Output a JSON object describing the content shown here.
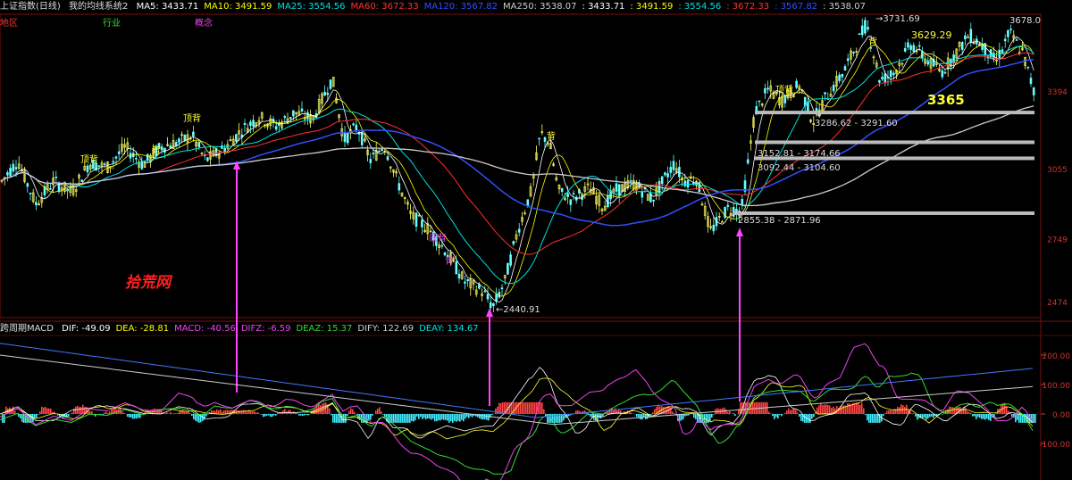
{
  "header": {
    "index_name": "上证指数(日线)",
    "indicator_name": "我的均线系统2",
    "ma": [
      {
        "label": "MA5: 3433.71",
        "color": "#ffffff"
      },
      {
        "label": "MA10: 3491.59",
        "color": "#ffff00"
      },
      {
        "label": "MA25: 3554.56",
        "color": "#00e0e0"
      },
      {
        "label": "MA60: 3672.33",
        "color": "#ff3030"
      },
      {
        "label": "MA120: 3567.82",
        "color": "#3050ff"
      },
      {
        "label": "MA250: 3538.07",
        "color": "#cccccc"
      },
      {
        "label": ": 3433.71",
        "color": "#ffffff"
      },
      {
        "label": ": 3491.59",
        "color": "#ffff00"
      },
      {
        "label": ": 3554.56",
        "color": "#00e0e0"
      },
      {
        "label": ": 3672.33",
        "color": "#ff3030"
      },
      {
        "label": ": 3567.82",
        "color": "#3050ff"
      },
      {
        "label": ": 3538.07",
        "color": "#cccccc"
      }
    ]
  },
  "tabs": [
    {
      "label": "地区",
      "color": "#ff3030"
    },
    {
      "label": "行业",
      "color": "#33dd33"
    },
    {
      "label": "概念",
      "color": "#ee44ee"
    }
  ],
  "watermark": "拾荒网",
  "chart_data": [
    {
      "type": "line",
      "title": "上证指数(日线)",
      "y_ticks": [
        "3394",
        "3055",
        "2749",
        "2474"
      ],
      "price_annotations": [
        "3731.69",
        "3678.0",
        "3629.29",
        "3365",
        "2440.91",
        "2855.38 - 2871.96"
      ],
      "support_zones": [
        "3286.62 - 3291.60",
        "3152.81 - 3174.66",
        "3092.44 - 3104.60",
        "2855.38 - 2871.96"
      ],
      "divergence_labels": [
        "顶背",
        "背",
        "顶背",
        "背",
        "底背",
        "背",
        "顶背",
        "背"
      ],
      "series": [
        {
          "name": "MA5",
          "color": "#ffffff"
        },
        {
          "name": "MA10",
          "color": "#ffff00"
        },
        {
          "name": "MA25",
          "color": "#00e0e0"
        },
        {
          "name": "MA60",
          "color": "#ff3030"
        },
        {
          "name": "MA120",
          "color": "#3050ff"
        },
        {
          "name": "MA250",
          "color": "#cccccc"
        }
      ]
    },
    {
      "type": "bar",
      "title": "跨周期MACD",
      "values_text": [
        {
          "label": "DIF: -49.09",
          "color": "#ffffff"
        },
        {
          "label": "DEA: -28.81",
          "color": "#ffff00"
        },
        {
          "label": "MACD: -40.56",
          "color": "#ee44ee"
        },
        {
          "label": "DIFZ: -6.59",
          "color": "#ee44ee"
        },
        {
          "label": "DEAZ: 15.37",
          "color": "#33dd33"
        },
        {
          "label": "DIFY: 122.69",
          "color": "#cccccc"
        },
        {
          "label": "DEAY: 134.67",
          "color": "#00e0e0"
        }
      ],
      "y_ticks": [
        "200.00",
        "100.00",
        "0.00",
        "-100.00"
      ]
    }
  ]
}
